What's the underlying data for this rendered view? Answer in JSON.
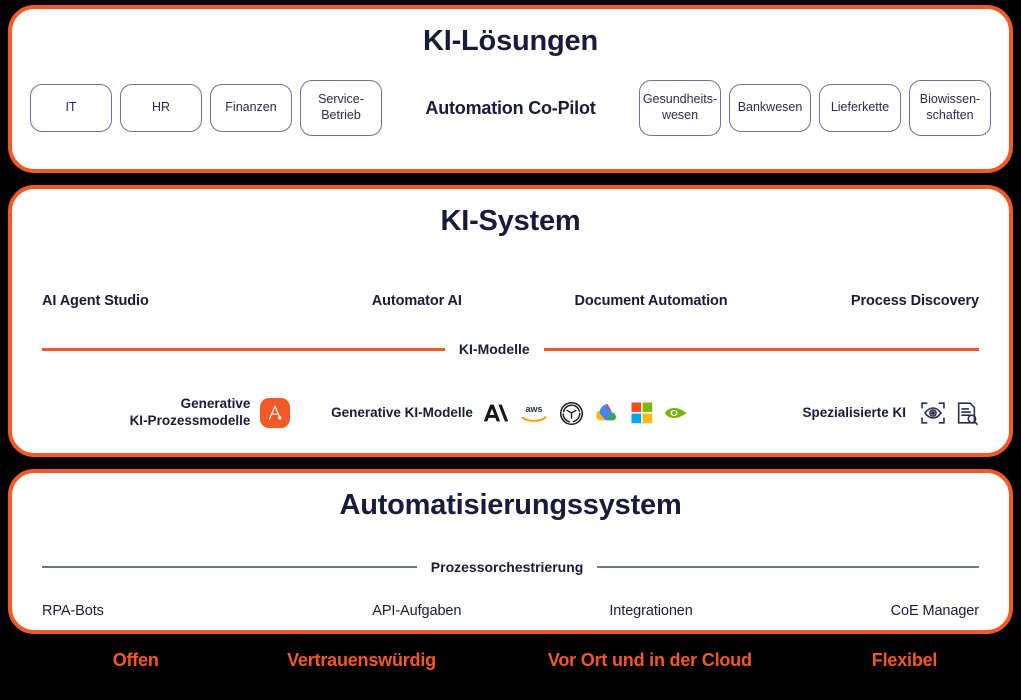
{
  "colors": {
    "accent_orange": "#F05A28",
    "text_navy": "#1A1B3A",
    "pill_border": "#6F7394",
    "background": "#000000",
    "panel_background": "#FFFFFF",
    "divider_gray": "#6F7390"
  },
  "solutions": {
    "title": "KI-Lösungen",
    "copilot_label": "Automation Co-Pilot",
    "pills_left": [
      {
        "label": "IT"
      },
      {
        "label": "HR"
      },
      {
        "label": "Finanzen"
      },
      {
        "label": "Service-\nBetrieb"
      }
    ],
    "pills_right": [
      {
        "label": "Gesundheits-\nwesen"
      },
      {
        "label": "Bankwesen"
      },
      {
        "label": "Lieferkette"
      },
      {
        "label": "Biowissen-\nschaften"
      }
    ]
  },
  "system": {
    "title": "KI-System",
    "capabilities": [
      {
        "label": "AI Agent Studio"
      },
      {
        "label": "Automator AI"
      },
      {
        "label": "Document Automation"
      },
      {
        "label": "Process Discovery"
      }
    ],
    "models_divider_caption": "KI-Modelle",
    "process_models": {
      "label": "Generative\nKI-Prozessmodelle",
      "icon": "automation-anywhere-logo"
    },
    "generative_models": {
      "label": "Generative KI-Modelle",
      "logos": [
        {
          "name": "anthropic-logo"
        },
        {
          "name": "aws-logo"
        },
        {
          "name": "openai-logo"
        },
        {
          "name": "google-cloud-logo"
        },
        {
          "name": "microsoft-logo"
        },
        {
          "name": "nvidia-logo"
        }
      ]
    },
    "specialized_ai": {
      "label": "Spezialisierte KI",
      "icons": [
        {
          "name": "computer-vision-eye-icon"
        },
        {
          "name": "document-search-icon"
        }
      ]
    }
  },
  "automation": {
    "title": "Automatisierungssystem",
    "orchestration_divider_caption": "Prozessorchestrierung",
    "capabilities": [
      {
        "label": "RPA-Bots"
      },
      {
        "label": "API-Aufgaben"
      },
      {
        "label": "Integrationen"
      },
      {
        "label": "CoE Manager"
      }
    ]
  },
  "footer": {
    "attributes": [
      {
        "label": "Offen"
      },
      {
        "label": "Vertrauenswürdig"
      },
      {
        "label": "Vor Ort und in der Cloud"
      },
      {
        "label": "Flexibel"
      }
    ]
  }
}
